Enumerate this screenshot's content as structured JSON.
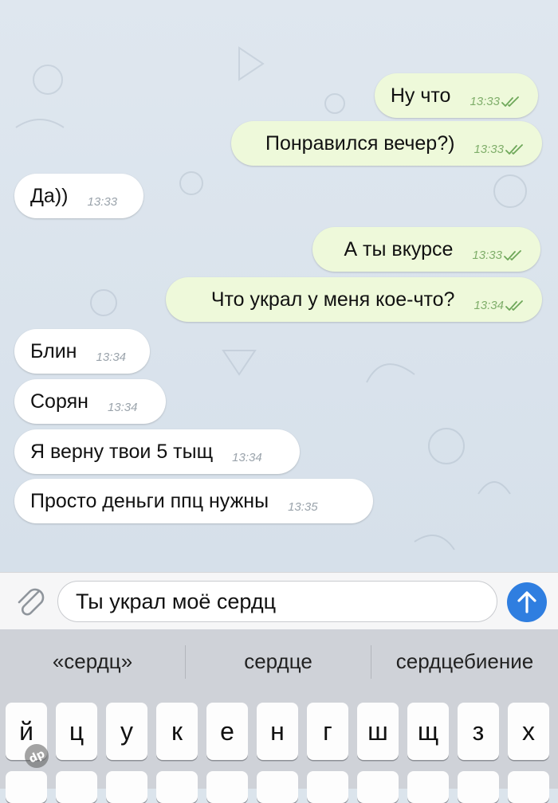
{
  "messages": [
    {
      "side": "out",
      "text": "Ну что",
      "time": "13:33",
      "read": true
    },
    {
      "side": "out",
      "text": "Понравился вечер?)",
      "time": "13:33",
      "read": true
    },
    {
      "side": "in",
      "text": "Да))",
      "time": "13:33"
    },
    {
      "side": "out",
      "text": "А ты вкурсе",
      "time": "13:33",
      "read": true
    },
    {
      "side": "out",
      "text": "Что украл у меня кое-что?",
      "time": "13:34",
      "read": true
    },
    {
      "side": "in",
      "text": "Блин",
      "time": "13:34"
    },
    {
      "side": "in",
      "text": "Сорян",
      "time": "13:34"
    },
    {
      "side": "in",
      "text": "Я верну твои 5 тыщ",
      "time": "13:34"
    },
    {
      "side": "in",
      "text": "Просто деньги ппц нужны",
      "time": "13:35"
    }
  ],
  "composer": {
    "draft": "Ты украл моё сердц",
    "attach_icon": "paperclip-icon",
    "send_icon": "arrow-up-icon",
    "send_color": "#2f7ee0"
  },
  "suggestions": [
    "«сердц»",
    "сердце",
    "сердцебиение"
  ],
  "keys": [
    "й",
    "ц",
    "у",
    "к",
    "е",
    "н",
    "г",
    "ш",
    "щ",
    "з",
    "х"
  ],
  "colors": {
    "outgoing": "#eef9da",
    "incoming": "#ffffff",
    "check": "#6fa85a"
  }
}
